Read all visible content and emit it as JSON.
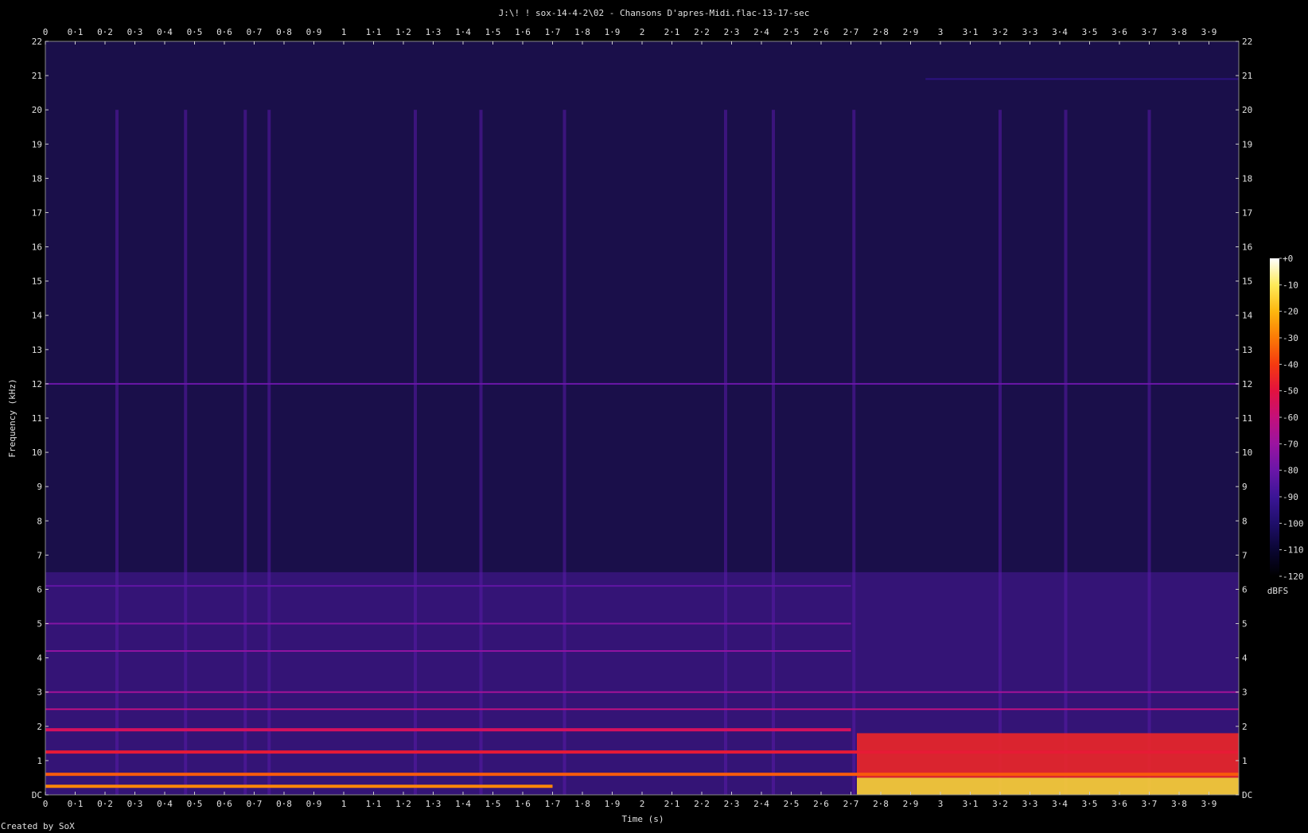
{
  "chart_data": {
    "type": "heatmap",
    "title": "J:\\! ! sox-14-4-2\\02 - Chansons D'apres-Midi.flac-13-17-sec",
    "xlabel": "Time (s)",
    "ylabel": "Frequency (kHz)",
    "xlim": [
      0,
      4.0
    ],
    "ylim": [
      0,
      22
    ],
    "x_ticks": [
      {
        "value": 0,
        "label": "0"
      },
      {
        "value": 0.1,
        "label": "0·1"
      },
      {
        "value": 0.2,
        "label": "0·2"
      },
      {
        "value": 0.3,
        "label": "0·3"
      },
      {
        "value": 0.4,
        "label": "0·4"
      },
      {
        "value": 0.5,
        "label": "0·5"
      },
      {
        "value": 0.6,
        "label": "0·6"
      },
      {
        "value": 0.7,
        "label": "0·7"
      },
      {
        "value": 0.8,
        "label": "0·8"
      },
      {
        "value": 0.9,
        "label": "0·9"
      },
      {
        "value": 1.0,
        "label": "1"
      },
      {
        "value": 1.1,
        "label": "1·1"
      },
      {
        "value": 1.2,
        "label": "1·2"
      },
      {
        "value": 1.3,
        "label": "1·3"
      },
      {
        "value": 1.4,
        "label": "1·4"
      },
      {
        "value": 1.5,
        "label": "1·5"
      },
      {
        "value": 1.6,
        "label": "1·6"
      },
      {
        "value": 1.7,
        "label": "1·7"
      },
      {
        "value": 1.8,
        "label": "1·8"
      },
      {
        "value": 1.9,
        "label": "1·9"
      },
      {
        "value": 2.0,
        "label": "2"
      },
      {
        "value": 2.1,
        "label": "2·1"
      },
      {
        "value": 2.2,
        "label": "2·2"
      },
      {
        "value": 2.3,
        "label": "2·3"
      },
      {
        "value": 2.4,
        "label": "2·4"
      },
      {
        "value": 2.5,
        "label": "2·5"
      },
      {
        "value": 2.6,
        "label": "2·6"
      },
      {
        "value": 2.7,
        "label": "2·7"
      },
      {
        "value": 2.8,
        "label": "2·8"
      },
      {
        "value": 2.9,
        "label": "2·9"
      },
      {
        "value": 3.0,
        "label": "3"
      },
      {
        "value": 3.1,
        "label": "3·1"
      },
      {
        "value": 3.2,
        "label": "3·2"
      },
      {
        "value": 3.3,
        "label": "3·3"
      },
      {
        "value": 3.4,
        "label": "3·4"
      },
      {
        "value": 3.5,
        "label": "3·5"
      },
      {
        "value": 3.6,
        "label": "3·6"
      },
      {
        "value": 3.7,
        "label": "3·7"
      },
      {
        "value": 3.8,
        "label": "3·8"
      },
      {
        "value": 3.9,
        "label": "3·9"
      }
    ],
    "y_ticks": [
      {
        "value": 0,
        "label": "DC"
      },
      {
        "value": 1,
        "label": "1"
      },
      {
        "value": 2,
        "label": "2"
      },
      {
        "value": 3,
        "label": "3"
      },
      {
        "value": 4,
        "label": "4"
      },
      {
        "value": 5,
        "label": "5"
      },
      {
        "value": 6,
        "label": "6"
      },
      {
        "value": 7,
        "label": "7"
      },
      {
        "value": 8,
        "label": "8"
      },
      {
        "value": 9,
        "label": "9"
      },
      {
        "value": 10,
        "label": "10"
      },
      {
        "value": 11,
        "label": "11"
      },
      {
        "value": 12,
        "label": "12"
      },
      {
        "value": 13,
        "label": "13"
      },
      {
        "value": 14,
        "label": "14"
      },
      {
        "value": 15,
        "label": "15"
      },
      {
        "value": 16,
        "label": "16"
      },
      {
        "value": 17,
        "label": "17"
      },
      {
        "value": 18,
        "label": "18"
      },
      {
        "value": 19,
        "label": "19"
      },
      {
        "value": 20,
        "label": "20"
      },
      {
        "value": 21,
        "label": "21"
      },
      {
        "value": 22,
        "label": "22"
      }
    ],
    "colorbar": {
      "label": "dBFS",
      "range": [
        -120,
        0
      ],
      "ticks": [
        {
          "value": 0,
          "label": "+0"
        },
        {
          "value": -10,
          "label": "-10"
        },
        {
          "value": -20,
          "label": "-20"
        },
        {
          "value": -30,
          "label": "-30"
        },
        {
          "value": -40,
          "label": "-40"
        },
        {
          "value": -50,
          "label": "-50"
        },
        {
          "value": -60,
          "label": "-60"
        },
        {
          "value": -70,
          "label": "-70"
        },
        {
          "value": -80,
          "label": "-80"
        },
        {
          "value": -90,
          "label": "-90"
        },
        {
          "value": -100,
          "label": "-100"
        },
        {
          "value": -110,
          "label": "-110"
        },
        {
          "value": -120,
          "label": "-120"
        }
      ],
      "colors": [
        "#000000",
        "#0a0633",
        "#1f0f6b",
        "#3b1596",
        "#6a16a8",
        "#9a14a0",
        "#c4107a",
        "#e3123f",
        "#f53a10",
        "#fb7a06",
        "#fdb70f",
        "#feeb5a",
        "#ffffff"
      ]
    },
    "background_color": "#1a0f4a",
    "note_onsets_s": [
      0.24,
      0.47,
      0.67,
      0.75,
      1.24,
      1.46,
      1.74,
      2.28,
      2.44,
      2.71,
      3.2,
      3.42,
      3.7
    ],
    "tonal_lines": [
      {
        "freq_khz": 12.0,
        "t_start": 0.0,
        "t_end": 4.0,
        "level_db": -80
      },
      {
        "freq_khz": 20.9,
        "t_start": 2.95,
        "t_end": 4.0,
        "level_db": -95
      },
      {
        "freq_khz": 0.25,
        "t_start": 0.0,
        "t_end": 1.7,
        "level_db": -28
      },
      {
        "freq_khz": 0.6,
        "t_start": 0.0,
        "t_end": 4.0,
        "level_db": -35
      },
      {
        "freq_khz": 1.25,
        "t_start": 0.0,
        "t_end": 4.0,
        "level_db": -48
      },
      {
        "freq_khz": 1.9,
        "t_start": 0.0,
        "t_end": 2.7,
        "level_db": -55
      },
      {
        "freq_khz": 2.5,
        "t_start": 0.0,
        "t_end": 4.0,
        "level_db": -62
      },
      {
        "freq_khz": 3.0,
        "t_start": 0.0,
        "t_end": 4.0,
        "level_db": -68
      },
      {
        "freq_khz": 4.2,
        "t_start": 0.0,
        "t_end": 2.7,
        "level_db": -72
      },
      {
        "freq_khz": 5.0,
        "t_start": 0.0,
        "t_end": 2.7,
        "level_db": -75
      },
      {
        "freq_khz": 6.1,
        "t_start": 0.0,
        "t_end": 2.7,
        "level_db": -82
      }
    ],
    "loud_regions": [
      {
        "t_start": 2.72,
        "t_end": 4.0,
        "f_low_khz": 0.0,
        "f_high_khz": 0.5,
        "level_db": -15
      },
      {
        "t_start": 2.72,
        "t_end": 4.0,
        "f_low_khz": 0.5,
        "f_high_khz": 1.8,
        "level_db": -45
      }
    ],
    "grid": false
  },
  "credit": "Created by SoX"
}
